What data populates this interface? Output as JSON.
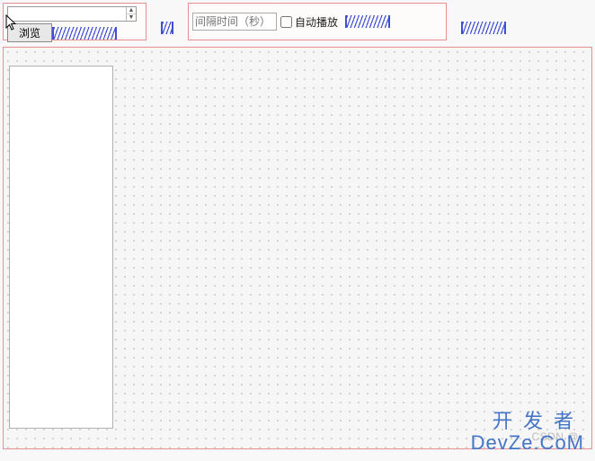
{
  "panel_left": {
    "spinner_value": "",
    "browse_label": "浏览"
  },
  "panel_right": {
    "interval_placeholder": "间隔时间（秒）",
    "autoplay_label": "自动播放",
    "autoplay_checked": false
  },
  "watermark": {
    "line1": "开发者",
    "line2": "DevZe.CoM",
    "csdn_prefix": "CSDN @"
  }
}
